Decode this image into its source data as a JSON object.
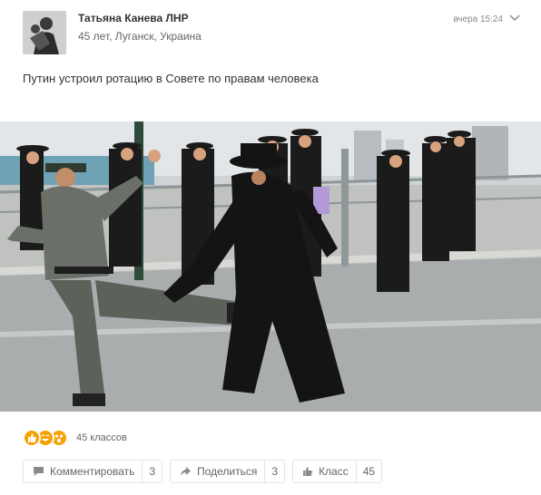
{
  "author": {
    "name": "Татьяна Канева ЛНР",
    "meta": "45 лет, Луганск, Украина"
  },
  "timestamp": "вчера 15:24",
  "post": {
    "text": "Путин устроил ротацию в Совете по правам человека"
  },
  "reactions": {
    "count_label": "45 классов",
    "icons": [
      "thumbs-up-emoji",
      "laughing-emoji",
      "surprised-emoji"
    ],
    "emoji_color": "#f7a000"
  },
  "actions": {
    "comment": {
      "label": "Комментировать",
      "count": "3",
      "icon": "comment-icon"
    },
    "share": {
      "label": "Поделиться",
      "count": "3",
      "icon": "share-icon"
    },
    "like": {
      "label": "Класс",
      "count": "45",
      "icon": "thumbs-up-icon"
    }
  }
}
